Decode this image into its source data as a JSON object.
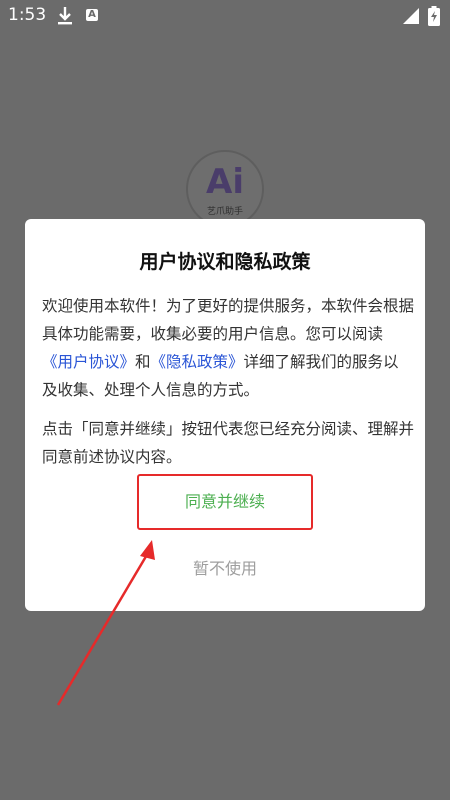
{
  "status_bar": {
    "time": "1:53",
    "download_icon": "download-icon",
    "notification_icon": "A",
    "signal_icon": "signal-icon",
    "battery_icon": "battery-charging-icon"
  },
  "logo": {
    "mark": "Ai",
    "caption": "艺爪助手"
  },
  "dialog": {
    "title": "用户协议和隐私政策",
    "para1_a": "欢迎使用本软件！为了更好的提供服务，本软件会根据具体功能需要，收集必要的用户信息。您可以阅读",
    "user_agreement_link": "《用户协议》",
    "para1_b": "和",
    "privacy_policy_link": "《隐私政策》",
    "para1_c": "详细了解我们的服务以及收集、处理个人信息的方式。",
    "para2": "点击「同意并继续」按钮代表您已经充分阅读、理解并同意前述协议内容。",
    "agree_label": "同意并继续",
    "decline_label": "暂不使用"
  },
  "colors": {
    "overlay": "#6b6b6b",
    "link": "#2a55d6",
    "agree_text": "#4caf50",
    "highlight_border": "#e62a2a",
    "decline_text": "#9e9e9e"
  }
}
